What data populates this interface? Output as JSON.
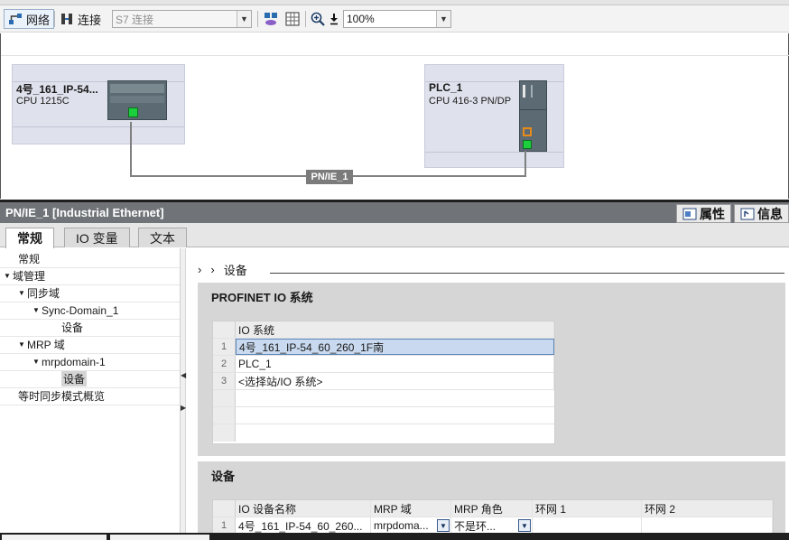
{
  "toolbar": {
    "network_label": "网络",
    "connections_label": "连接",
    "connection_type": "S7 连接",
    "zoom": "100%"
  },
  "canvas": {
    "devices": [
      {
        "name": "4号_161_IP-54...",
        "type": "CPU 1215C"
      },
      {
        "name": "PLC_1",
        "type": "CPU 416-3 PN/DP"
      }
    ],
    "subnet_label": "PN/IE_1"
  },
  "properties": {
    "title": "PN/IE_1 [Industrial Ethernet]",
    "right_tabs": {
      "properties": "属性",
      "info": "信息"
    },
    "tabs": [
      "常规",
      "IO 变量",
      "文本"
    ]
  },
  "tree": {
    "items": [
      {
        "label": "常规"
      },
      {
        "label": "域管理"
      },
      {
        "label": "同步域"
      },
      {
        "label": "Sync-Domain_1"
      },
      {
        "label": "设备"
      },
      {
        "label": "MRP 域"
      },
      {
        "label": "mrpdomain-1"
      },
      {
        "label": "设备"
      },
      {
        "label": "等时同步模式概览"
      }
    ]
  },
  "content": {
    "breadcrumb": "设备",
    "io_section": {
      "title": "PROFINET IO 系统",
      "header": "IO 系统",
      "rows": [
        {
          "num": "1",
          "value": "4号_161_IP-54_60_260_1F南"
        },
        {
          "num": "2",
          "value": "PLC_1"
        },
        {
          "num": "3",
          "value": "<选择站/IO 系统>"
        }
      ]
    },
    "device_section": {
      "title": "设备",
      "headers": [
        "IO 设备名称",
        "MRP 域",
        "MRP 角色",
        "环网 1",
        "环网 2"
      ],
      "rows": [
        {
          "num": "1",
          "device": "4号_161_IP-54_60_260...",
          "mrp_domain": "mrpdoma...",
          "mrp_role": "不是环...",
          "ring1": "",
          "ring2": ""
        }
      ]
    }
  },
  "colors": {
    "device_box": "#dfe1ec",
    "header_bar": "#707478",
    "selection": "#c9d9ef",
    "subnet": "#7b7b7b",
    "port_green": "#1ccf3c",
    "port_orange": "#e88b1a"
  }
}
